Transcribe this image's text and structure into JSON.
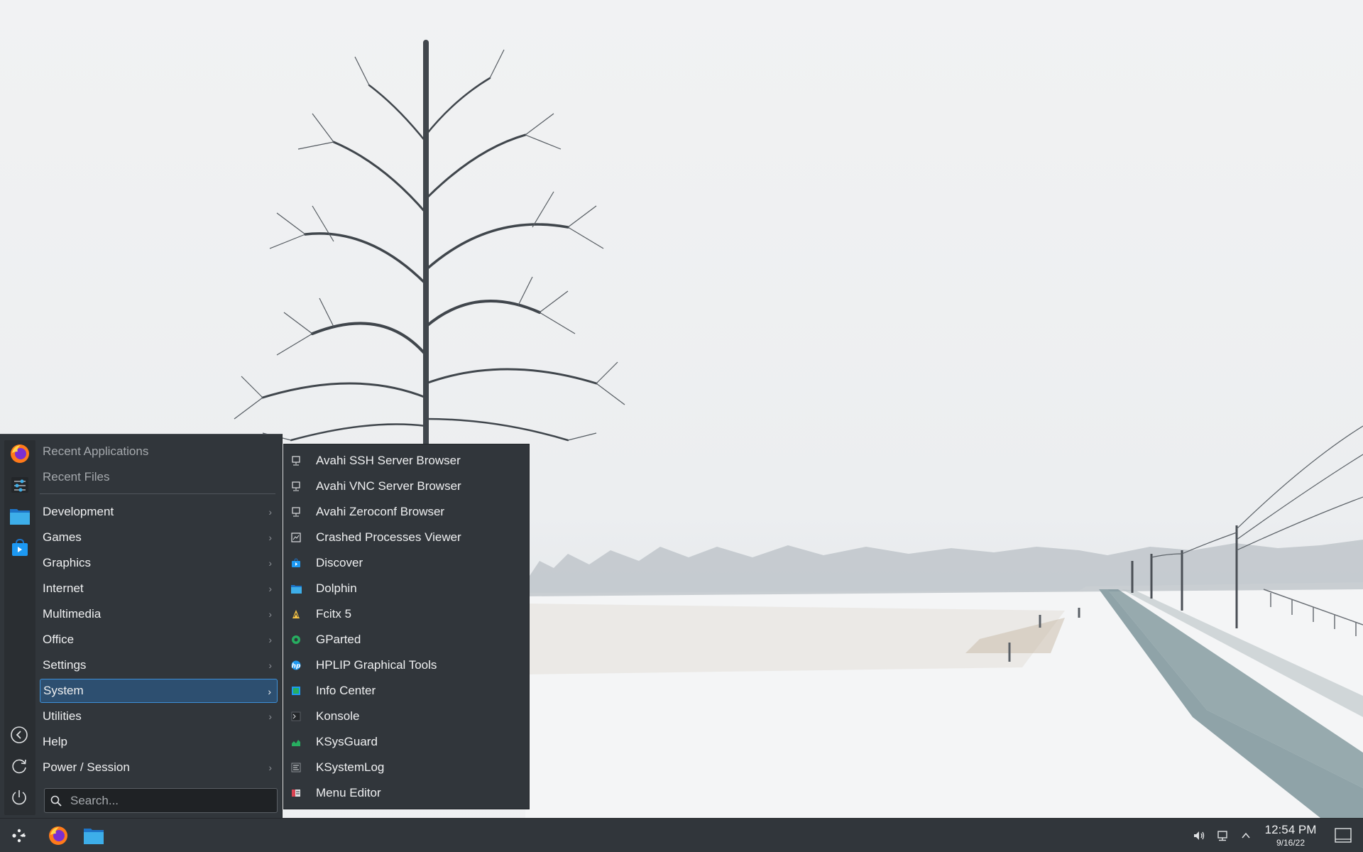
{
  "launcher": {
    "favorites": [
      "firefox-icon",
      "system-settings-icon",
      "dolphin-icon",
      "discover-icon"
    ],
    "header_items": [
      {
        "label": "Recent Applications"
      },
      {
        "label": "Recent Files"
      }
    ],
    "categories": [
      {
        "label": "Development",
        "has_submenu": true
      },
      {
        "label": "Games",
        "has_submenu": true
      },
      {
        "label": "Graphics",
        "has_submenu": true
      },
      {
        "label": "Internet",
        "has_submenu": true
      },
      {
        "label": "Multimedia",
        "has_submenu": true
      },
      {
        "label": "Office",
        "has_submenu": true
      },
      {
        "label": "Settings",
        "has_submenu": true
      },
      {
        "label": "System",
        "has_submenu": true,
        "selected": true
      },
      {
        "label": "Utilities",
        "has_submenu": true
      },
      {
        "label": "Help",
        "has_submenu": false
      },
      {
        "label": "Power / Session",
        "has_submenu": true
      }
    ],
    "search": {
      "placeholder": "Search..."
    },
    "side_actions": [
      "back-icon",
      "refresh-icon",
      "power-icon"
    ],
    "arrow_glyph": "›"
  },
  "system_submenu": {
    "items": [
      {
        "label": "Avahi SSH Server Browser",
        "icon": "network-icon"
      },
      {
        "label": "Avahi VNC Server Browser",
        "icon": "network-icon"
      },
      {
        "label": "Avahi Zeroconf Browser",
        "icon": "network-icon"
      },
      {
        "label": "Crashed Processes Viewer",
        "icon": "crash-icon"
      },
      {
        "label": "Discover",
        "icon": "discover-icon"
      },
      {
        "label": "Dolphin",
        "icon": "dolphin-icon"
      },
      {
        "label": "Fcitx 5",
        "icon": "fcitx-icon"
      },
      {
        "label": "GParted",
        "icon": "gparted-icon"
      },
      {
        "label": "HPLIP Graphical Tools",
        "icon": "hplip-icon"
      },
      {
        "label": "Info Center",
        "icon": "info-center-icon"
      },
      {
        "label": "Konsole",
        "icon": "konsole-icon"
      },
      {
        "label": "KSysGuard",
        "icon": "ksysguard-icon"
      },
      {
        "label": "KSystemLog",
        "icon": "ksystemlog-icon"
      },
      {
        "label": "Menu Editor",
        "icon": "menu-editor-icon"
      }
    ]
  },
  "taskbar": {
    "launchers": [
      "application-launcher-icon",
      "firefox-icon",
      "dolphin-icon"
    ],
    "tray": [
      "volume-icon",
      "network-icon",
      "expand-tray-icon"
    ],
    "clock": {
      "time": "12:54 PM",
      "date": "9/16/22"
    },
    "show_desktop": "show-desktop-icon"
  },
  "colors": {
    "panel": "#31363b",
    "accent": "#3d90d8",
    "selection": "#2d4f70",
    "text": "#eff0f1"
  }
}
